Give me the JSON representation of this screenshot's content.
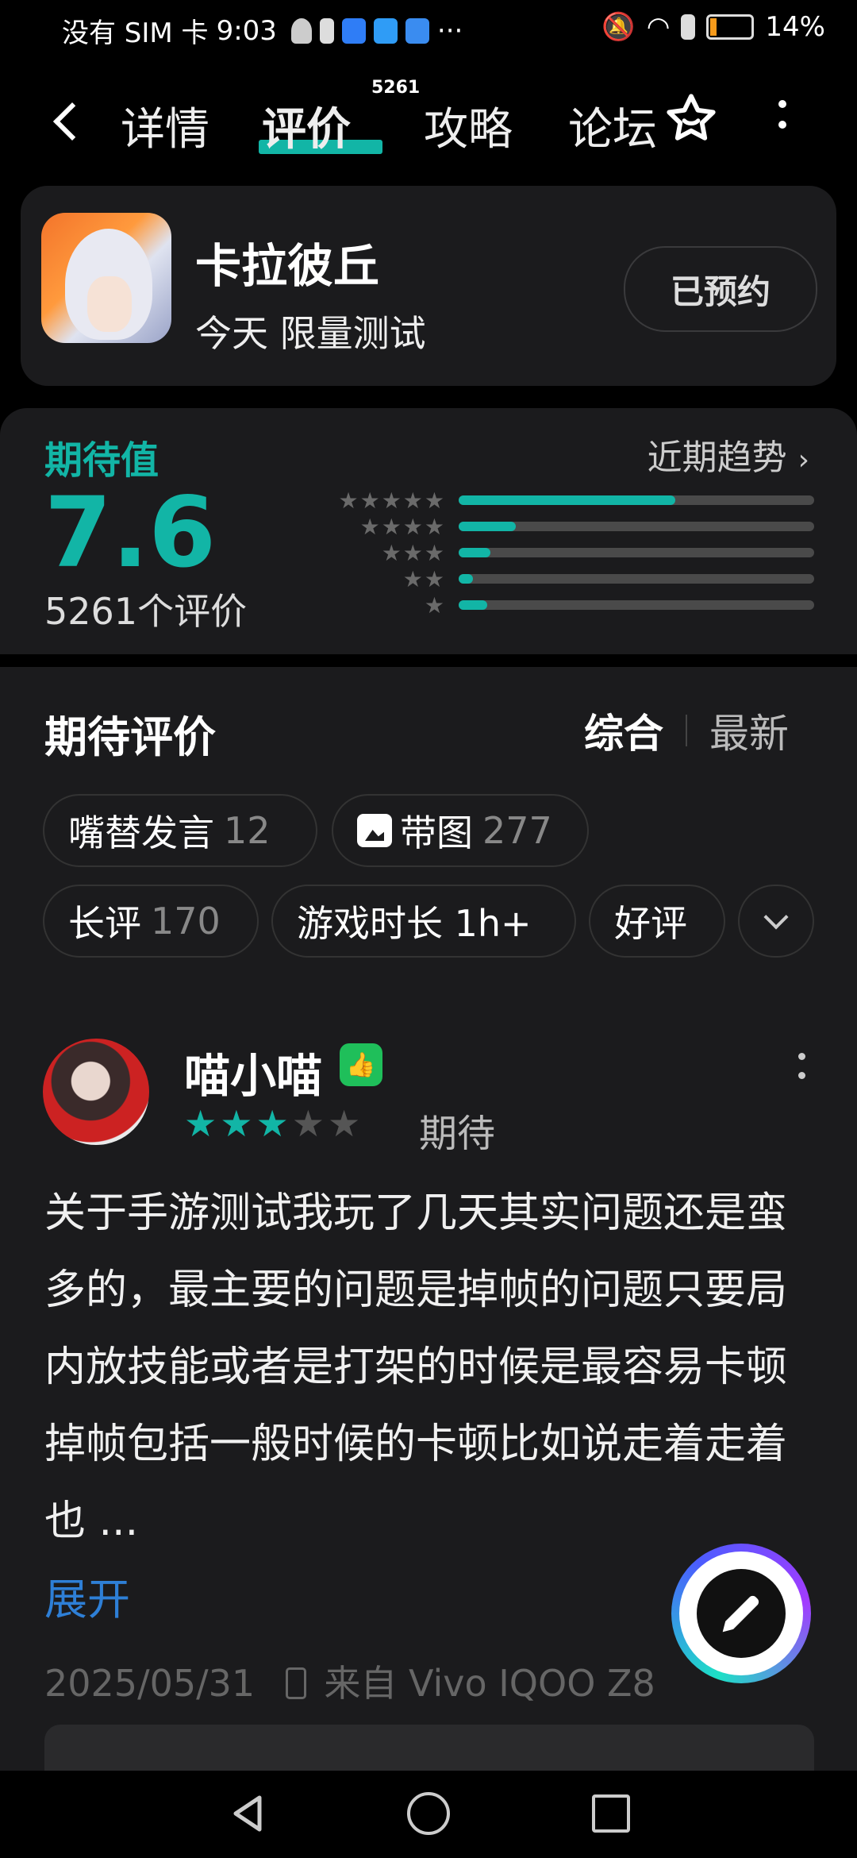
{
  "status_bar": {
    "left_text": "没有 SIM 卡",
    "time": "9:03",
    "more": "···",
    "battery": "14%"
  },
  "nav": {
    "back_icon": "chevron-left-icon",
    "tabs": [
      "详情",
      "评价",
      "攻略",
      "论坛"
    ],
    "active_tab": "评价",
    "badge": "5261",
    "favorite_icon": "star-icon",
    "more_icon": "more-vertical-icon",
    "accent": "#12b5a6"
  },
  "game": {
    "title": "卡拉彼丘",
    "subtitle": "今天 限量测试",
    "reserve_label": "已预约"
  },
  "rating": {
    "label": "期待值",
    "trend_label": "近期趋势",
    "score": "7.6",
    "count": "5261个评价",
    "distribution": [
      0.61,
      0.16,
      0.09,
      0.04,
      0.08
    ]
  },
  "reviews": {
    "title": "期待评价",
    "sort_options": [
      "综合",
      "最新"
    ],
    "chips": [
      {
        "label": "嘴替发言",
        "count": "12"
      },
      {
        "label": "带图",
        "count": "277"
      },
      {
        "label": "长评",
        "count": "170"
      },
      {
        "label": "游戏时长 1h+",
        "count": ""
      },
      {
        "label": "好评",
        "count": ""
      }
    ],
    "item": {
      "username": "喵小喵",
      "stars": 3,
      "tag": "期待",
      "text": "关于手游测试我玩了几天其实问题还是蛮多的，最主要的问题是掉帧的问题只要局内放技能或者是打架的时候是最容易卡顿掉帧包括一般时候的卡顿比如说走着走着也 ...",
      "expand_label": "展开",
      "date": "2025/05/31",
      "device": "来自 Vivo IQOO Z8"
    }
  }
}
